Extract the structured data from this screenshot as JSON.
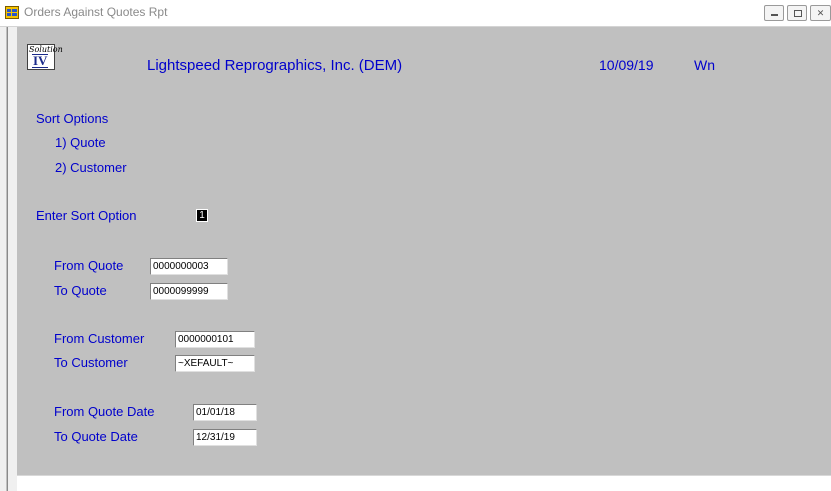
{
  "window": {
    "title": "Orders Against Quotes Rpt",
    "icon": "app-grid-icon"
  },
  "header": {
    "logo_script": "Solution",
    "logo_roman": "IV",
    "company": "Lightspeed Reprographics, Inc. (DEM)",
    "date": "10/09/19",
    "user": "Wn"
  },
  "sort_options": {
    "heading": "Sort Options",
    "option1": "1) Quote",
    "option2": "2) Customer",
    "prompt": "Enter Sort Option",
    "value": "1"
  },
  "ranges": {
    "from_quote_label": "From Quote",
    "from_quote_value": "0000000003",
    "to_quote_label": "To Quote",
    "to_quote_value": "0000099999",
    "from_customer_label": "From Customer",
    "from_customer_value": "0000000101",
    "to_customer_label": "To Customer",
    "to_customer_value": "~XEFAULT~",
    "from_date_label": "From Quote Date",
    "from_date_value": "01/01/18",
    "to_date_label": "To Quote Date",
    "to_date_value": "12/31/19"
  },
  "colors": {
    "label_blue": "#0000cc",
    "client_gray": "#c0c0c0"
  }
}
